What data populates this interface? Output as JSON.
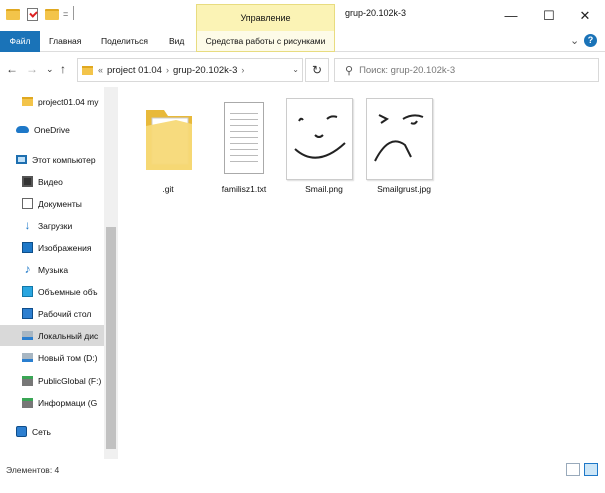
{
  "window": {
    "title": "grup-20.102k-3",
    "minimize_glyph": "—",
    "maximize_glyph": "☐",
    "close_glyph": "✕",
    "quick_access_separator": "="
  },
  "ribbon": {
    "context_header": "Управление",
    "tabs": [
      {
        "label": "Файл"
      },
      {
        "label": "Главная"
      },
      {
        "label": "Поделиться"
      },
      {
        "label": "Вид"
      },
      {
        "label": "Средства работы с рисунками"
      }
    ],
    "expand_glyph": "⌄",
    "help_glyph": "?"
  },
  "navigation": {
    "back_glyph": "←",
    "forward_glyph": "→",
    "recent_glyph": "⌄",
    "up_glyph": "↑",
    "overflow_glyph": "«",
    "breadcrumb": [
      "project 01.04",
      "grup-20.102k-3"
    ],
    "separator_glyph": "›",
    "dropdown_glyph": "⌄",
    "refresh_glyph": "↻"
  },
  "search": {
    "icon_glyph": "⚲",
    "placeholder": "Поиск: grup-20.102k-3"
  },
  "sidebar": {
    "items": [
      {
        "label": "project01.04 my",
        "icon": "folder-icon"
      },
      {
        "label": "OneDrive",
        "icon": "cloud-icon"
      },
      {
        "label": "Этот компьютер",
        "icon": "computer-icon"
      },
      {
        "label": "Видео",
        "icon": "video-icon"
      },
      {
        "label": "Документы",
        "icon": "document-icon"
      },
      {
        "label": "Загрузки",
        "icon": "download-icon",
        "glyph": "↓"
      },
      {
        "label": "Изображения",
        "icon": "images-icon"
      },
      {
        "label": "Музыка",
        "icon": "music-icon",
        "glyph": "♪"
      },
      {
        "label": "Объемные объ",
        "icon": "3d-objects-icon"
      },
      {
        "label": "Рабочий стол",
        "icon": "desktop-icon"
      },
      {
        "label": "Локальный дис",
        "icon": "local-disk-icon"
      },
      {
        "label": "Новый том (D:)",
        "icon": "disk-icon"
      },
      {
        "label": "PublicGlobal (F:)",
        "icon": "usb-drive-icon"
      },
      {
        "label": "Информаци (G",
        "icon": "usb-drive-icon"
      },
      {
        "label": "Сеть",
        "icon": "network-icon"
      }
    ]
  },
  "files": [
    {
      "name": ".git",
      "type": "folder"
    },
    {
      "name": "familisz1.txt",
      "type": "text"
    },
    {
      "name": "Smail.png",
      "type": "image"
    },
    {
      "name": "Smailgrust.jpg",
      "type": "image"
    }
  ],
  "status": {
    "items_count": "Элементов: 4"
  },
  "colors": {
    "accent": "#1a73b8",
    "context_tab": "#fbf3b5",
    "folder": "#f3c44a"
  }
}
